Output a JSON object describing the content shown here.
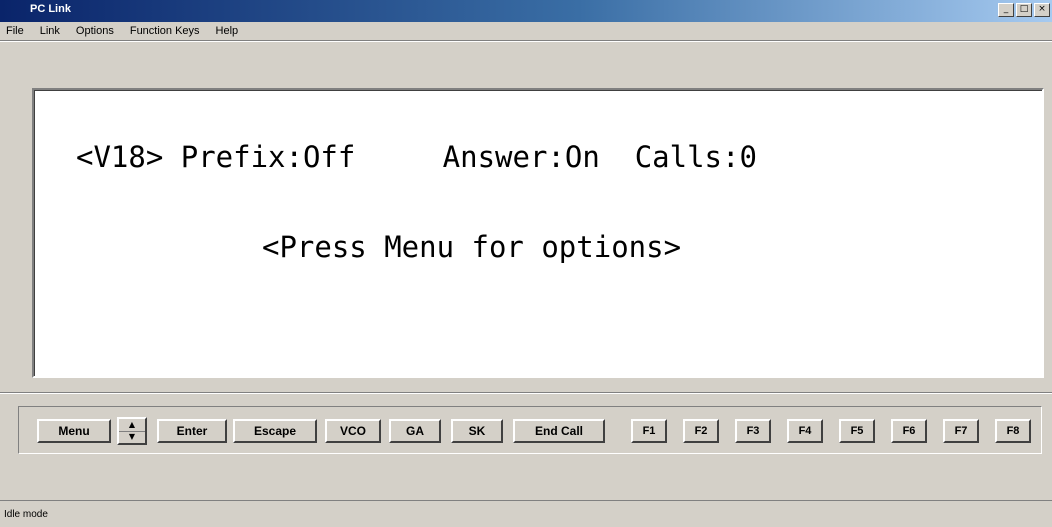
{
  "window": {
    "title": "PC Link"
  },
  "window_controls": [
    "_",
    "□",
    "×"
  ],
  "menu": [
    "File",
    "Link",
    "Options",
    "Function Keys",
    "Help"
  ],
  "terminal": {
    "line1": "<V18> Prefix:Off     Answer:On  Calls:0",
    "line2": "<Press Menu for options>"
  },
  "buttons": {
    "menu": "Menu",
    "spin_up": "▲",
    "spin_down": "▼",
    "enter": "Enter",
    "escape": "Escape",
    "vco": "VCO",
    "ga": "GA",
    "sk": "SK",
    "end_call": "End Call",
    "f": [
      "F1",
      "F2",
      "F3",
      "F4",
      "F5",
      "F6",
      "F7",
      "F8"
    ]
  },
  "status": "Idle mode"
}
